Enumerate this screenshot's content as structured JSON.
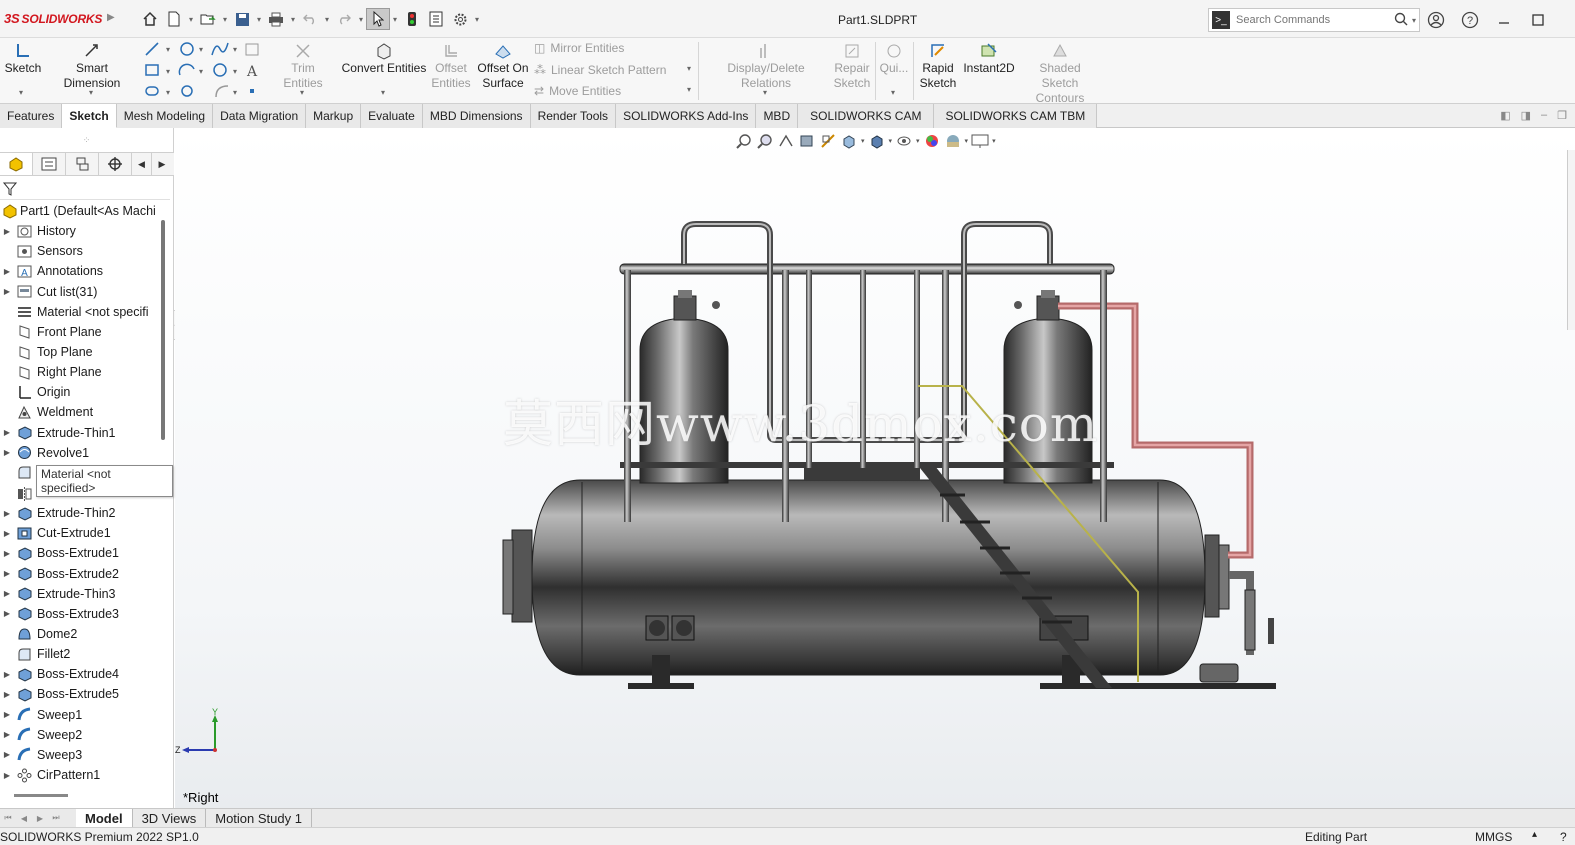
{
  "app": {
    "brand": "SOLIDWORKS",
    "document_title": "Part1.SLDPRT"
  },
  "search": {
    "placeholder": "Search Commands"
  },
  "ribbon": {
    "sketch": "Sketch",
    "smart_dimension": "Smart Dimension",
    "trim_entities": "Trim Entities",
    "convert_entities": "Convert Entities",
    "offset_entities": "Offset Entities",
    "offset_on_surface": "Offset On Surface",
    "mirror_entities": "Mirror Entities",
    "linear_sketch_pattern": "Linear Sketch Pattern",
    "move_entities": "Move Entities",
    "display_delete_relations": "Display/Delete Relations",
    "repair_sketch": "Repair Sketch",
    "quick_snaps": "Qui...",
    "rapid_sketch": "Rapid Sketch",
    "instant2d": "Instant2D",
    "shaded_sketch_contours": "Shaded Sketch Contours"
  },
  "tabs": [
    {
      "label": "Features",
      "active": false
    },
    {
      "label": "Sketch",
      "active": true
    },
    {
      "label": "Mesh Modeling",
      "active": false
    },
    {
      "label": "Data Migration",
      "active": false
    },
    {
      "label": "Markup",
      "active": false
    },
    {
      "label": "Evaluate",
      "active": false
    },
    {
      "label": "MBD Dimensions",
      "active": false
    },
    {
      "label": "Render Tools",
      "active": false
    },
    {
      "label": "SOLIDWORKS Add-Ins",
      "active": false
    },
    {
      "label": "MBD",
      "active": false
    },
    {
      "label": "SOLIDWORKS CAM",
      "active": false
    },
    {
      "label": "SOLIDWORKS CAM TBM",
      "active": false
    }
  ],
  "feature_tree": {
    "root": "Part1  (Default<As Machi",
    "tooltip": "Material <not specified>",
    "items": [
      {
        "label": "History",
        "icon": "history-icon",
        "expandable": true
      },
      {
        "label": "Sensors",
        "icon": "sensors-icon",
        "expandable": false
      },
      {
        "label": "Annotations",
        "icon": "annotations-icon",
        "expandable": true
      },
      {
        "label": "Cut list(31)",
        "icon": "cut-list-icon",
        "expandable": true
      },
      {
        "label": "Material <not specifi",
        "icon": "material-icon",
        "expandable": false
      },
      {
        "label": "Front Plane",
        "icon": "plane-icon",
        "expandable": false
      },
      {
        "label": "Top Plane",
        "icon": "plane-icon",
        "expandable": false
      },
      {
        "label": "Right Plane",
        "icon": "plane-icon",
        "expandable": false
      },
      {
        "label": "Origin",
        "icon": "origin-icon",
        "expandable": false
      },
      {
        "label": "Weldment",
        "icon": "weldment-icon",
        "expandable": false
      },
      {
        "label": "Extrude-Thin1",
        "icon": "extrude-icon",
        "expandable": true
      },
      {
        "label": "Revolve1",
        "icon": "revolve-icon",
        "expandable": true
      },
      {
        "label": "Fillet1",
        "icon": "fillet-icon",
        "expandable": false
      },
      {
        "label": "Mirror1",
        "icon": "mirror-icon",
        "expandable": false
      },
      {
        "label": "Extrude-Thin2",
        "icon": "extrude-icon",
        "expandable": true
      },
      {
        "label": "Cut-Extrude1",
        "icon": "cut-extrude-icon",
        "expandable": true
      },
      {
        "label": "Boss-Extrude1",
        "icon": "extrude-icon",
        "expandable": true
      },
      {
        "label": "Boss-Extrude2",
        "icon": "extrude-icon",
        "expandable": true
      },
      {
        "label": "Extrude-Thin3",
        "icon": "extrude-icon",
        "expandable": true
      },
      {
        "label": "Boss-Extrude3",
        "icon": "extrude-icon",
        "expandable": true
      },
      {
        "label": "Dome2",
        "icon": "dome-icon",
        "expandable": false
      },
      {
        "label": "Fillet2",
        "icon": "fillet-icon",
        "expandable": false
      },
      {
        "label": "Boss-Extrude4",
        "icon": "extrude-icon",
        "expandable": true
      },
      {
        "label": "Boss-Extrude5",
        "icon": "extrude-icon",
        "expandable": true
      },
      {
        "label": "Sweep1",
        "icon": "sweep-icon",
        "expandable": true
      },
      {
        "label": "Sweep2",
        "icon": "sweep-icon",
        "expandable": true
      },
      {
        "label": "Sweep3",
        "icon": "sweep-icon",
        "expandable": true
      },
      {
        "label": "CirPattern1",
        "icon": "circular-pattern-icon",
        "expandable": true
      }
    ]
  },
  "viewport": {
    "view_label": "*Right",
    "watermark": "莫西网www.3dmox.com",
    "triad": {
      "y": "Y",
      "z": "Z"
    }
  },
  "bottom_tabs": [
    {
      "label": "Model",
      "active": true
    },
    {
      "label": "3D Views",
      "active": false
    },
    {
      "label": "Motion Study 1",
      "active": false
    }
  ],
  "status": {
    "product": "SOLIDWORKS Premium 2022 SP1.0",
    "mode": "Editing Part",
    "units": "MMGS",
    "help": "?"
  },
  "colors": {
    "brand_red": "#d2161e",
    "pipe_red": "#c97a7a",
    "ladder_yellow": "#b8b24a"
  }
}
